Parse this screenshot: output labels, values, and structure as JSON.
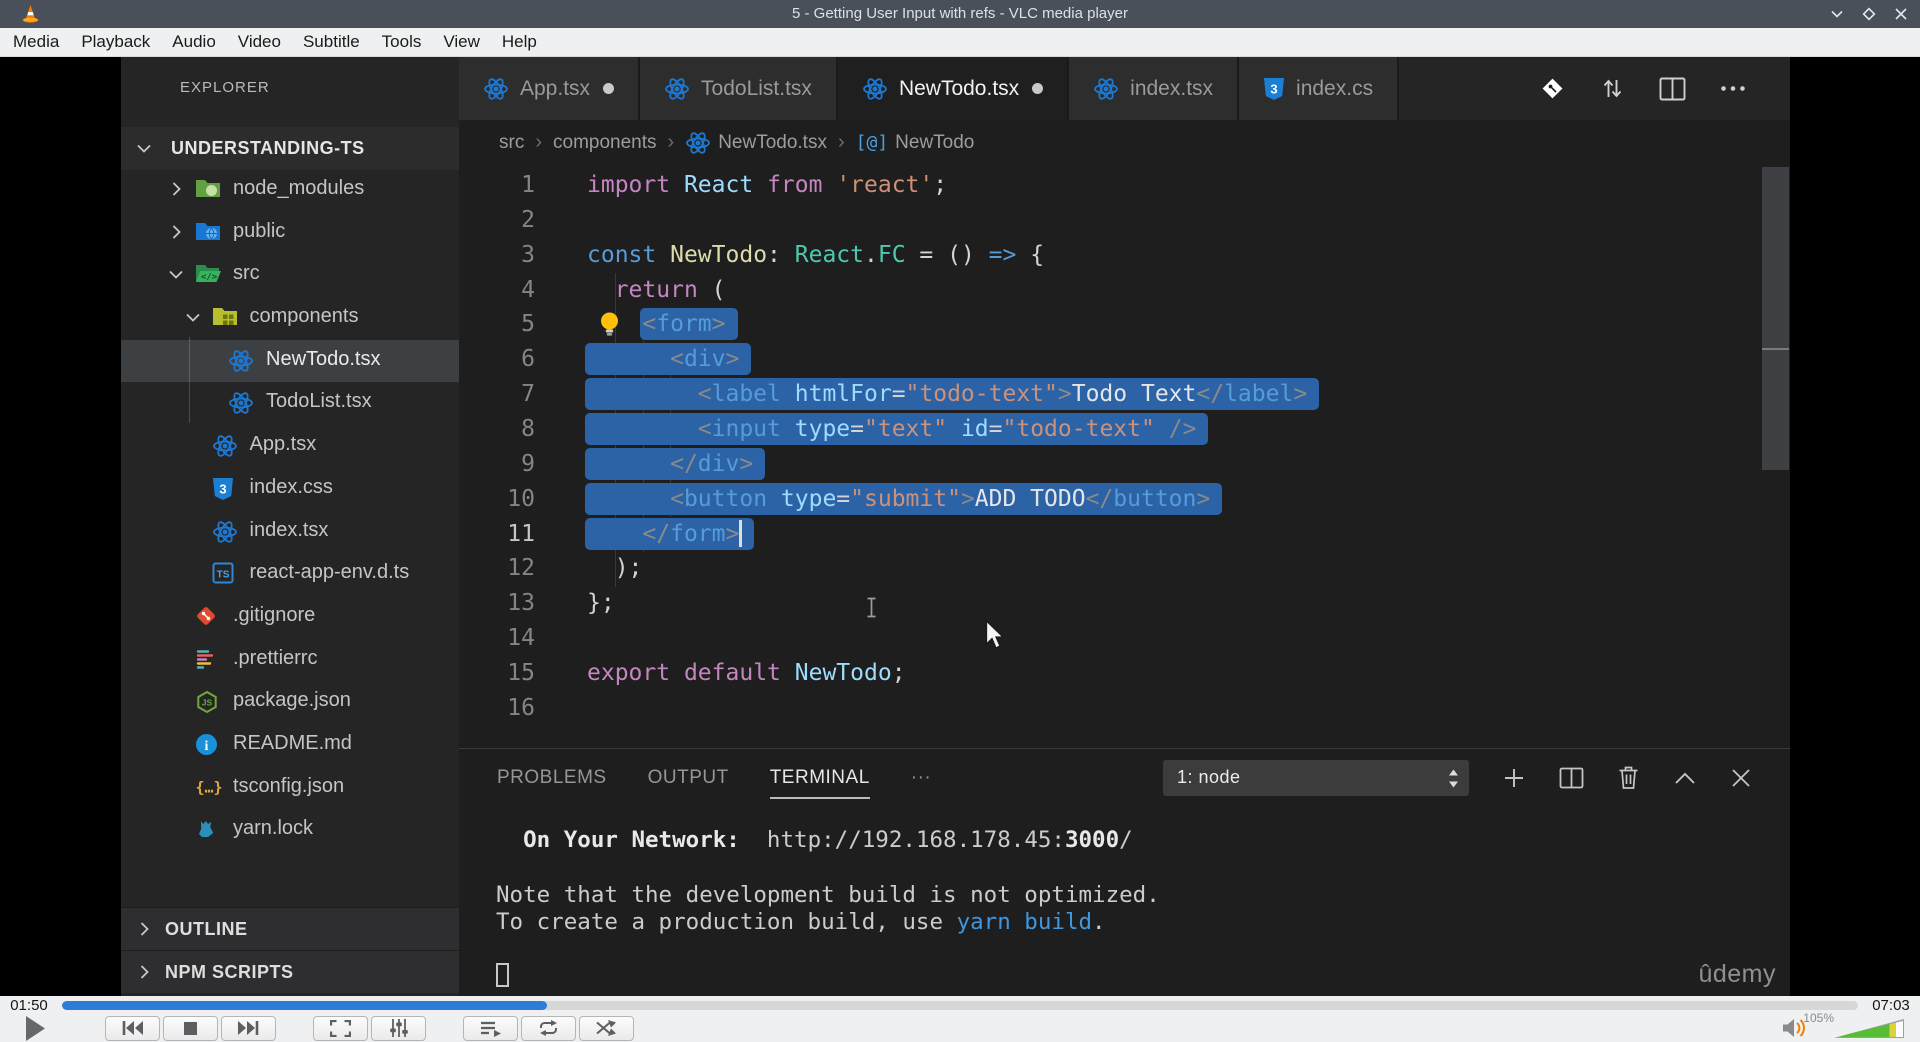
{
  "vlc": {
    "title": "5 - Getting User Input with refs - VLC media player",
    "menu": [
      "Media",
      "Playback",
      "Audio",
      "Video",
      "Subtitle",
      "Tools",
      "View",
      "Help"
    ],
    "window_controls": [
      "minimize",
      "maximize",
      "close"
    ],
    "seek": {
      "elapsed": "01:50",
      "total": "07:03",
      "progress_pct": 27
    },
    "button_groups": [
      [
        "skip-back",
        "stop",
        "skip-forward"
      ],
      [
        "fullscreen",
        "adjustments"
      ],
      [
        "playlist",
        "loop",
        "random"
      ]
    ],
    "volume": {
      "label": "105%",
      "fill_pct": 80
    },
    "colors": {
      "seek_fill": "#2e7cd6",
      "titlebar": "#4a5059",
      "menubar": "#eff0f1"
    }
  },
  "video": {
    "watermark": "ûdemy"
  },
  "vscode": {
    "explorer": {
      "header": "EXPLORER",
      "project": "UNDERSTANDING-TS",
      "items": [
        {
          "label": "node_modules",
          "icon": "folder-node-modules",
          "chevron": "right",
          "indent": 1
        },
        {
          "label": "public",
          "icon": "folder-public",
          "chevron": "right",
          "indent": 1
        },
        {
          "label": "src",
          "icon": "folder-src",
          "chevron": "down",
          "indent": 1
        },
        {
          "label": "components",
          "icon": "folder-components",
          "chevron": "down",
          "indent": 2
        },
        {
          "label": "NewTodo.tsx",
          "icon": "react",
          "indent": 3,
          "selected": true
        },
        {
          "label": "TodoList.tsx",
          "icon": "react",
          "indent": 3
        },
        {
          "label": "App.tsx",
          "icon": "react",
          "indent": 2
        },
        {
          "label": "index.css",
          "icon": "css",
          "indent": 2
        },
        {
          "label": "index.tsx",
          "icon": "react",
          "indent": 2
        },
        {
          "label": "react-app-env.d.ts",
          "icon": "ts",
          "indent": 2
        },
        {
          "label": ".gitignore",
          "icon": "git",
          "indent": 1
        },
        {
          "label": ".prettierrc",
          "icon": "prettier",
          "indent": 1
        },
        {
          "label": "package.json",
          "icon": "node",
          "indent": 1
        },
        {
          "label": "README.md",
          "icon": "info",
          "indent": 1
        },
        {
          "label": "tsconfig.json",
          "icon": "braces",
          "indent": 1
        },
        {
          "label": "yarn.lock",
          "icon": "yarn",
          "indent": 1
        }
      ],
      "sections": [
        {
          "label": "OUTLINE"
        },
        {
          "label": "NPM SCRIPTS"
        }
      ]
    },
    "tabs": [
      {
        "label": "App.tsx",
        "icon": "react",
        "modified": true,
        "active": false
      },
      {
        "label": "TodoList.tsx",
        "icon": "react",
        "modified": false,
        "active": false
      },
      {
        "label": "NewTodo.tsx",
        "icon": "react",
        "modified": true,
        "active": true
      },
      {
        "label": "index.tsx",
        "icon": "react",
        "modified": false,
        "active": false
      },
      {
        "label": "index.cs",
        "icon": "css",
        "modified": false,
        "active": false
      }
    ],
    "editor_actions": [
      "git-diamond",
      "swap-arrows",
      "split-editor",
      "more-actions"
    ],
    "breadcrumb": [
      {
        "label": "src"
      },
      {
        "label": "components"
      },
      {
        "label": "NewTodo.tsx",
        "icon": "react"
      },
      {
        "label": "NewTodo",
        "symbol": "[@]"
      }
    ],
    "code": {
      "token_colors": {
        "pl": "#d4d4d4",
        "kw": "#c586c0",
        "kw2": "#569cd6",
        "fn": "#dcdcaa",
        "type": "#4ec9b0",
        "var": "#9cdcfe",
        "str": "#ce9178",
        "tag": "#569cd6",
        "attr": "#9cdcfe",
        "punc": "#8a8a8a",
        "txt": "#e6e6e6"
      },
      "selection_color": "#2b63a6",
      "lines": [
        {
          "num": 1,
          "tokens": [
            [
              "kw",
              "import"
            ],
            [
              "pl",
              " "
            ],
            [
              "var",
              "React"
            ],
            [
              "pl",
              " "
            ],
            [
              "kw",
              "from"
            ],
            [
              "pl",
              " "
            ],
            [
              "str",
              "'react'"
            ],
            [
              "pl",
              ";"
            ]
          ]
        },
        {
          "num": 2,
          "tokens": []
        },
        {
          "num": 3,
          "tokens": [
            [
              "kw2",
              "const"
            ],
            [
              "pl",
              " "
            ],
            [
              "fn",
              "NewTodo"
            ],
            [
              "pl",
              ": "
            ],
            [
              "type",
              "React"
            ],
            [
              "pl",
              "."
            ],
            [
              "type",
              "FC"
            ],
            [
              "pl",
              " = () "
            ],
            [
              "kw2",
              "=>"
            ],
            [
              "pl",
              " {"
            ]
          ]
        },
        {
          "num": 4,
          "tokens": [
            [
              "pl",
              "  "
            ],
            [
              "kw",
              "return"
            ],
            [
              "pl",
              " ("
            ]
          ]
        },
        {
          "num": 5,
          "lightbulb": true,
          "tokens": [
            [
              "pl",
              "    "
            ]
          ],
          "sel": [
            [
              "punc",
              "<"
            ],
            [
              "tag",
              "form"
            ],
            [
              "punc",
              ">"
            ]
          ]
        },
        {
          "num": 6,
          "sel": [
            [
              "pl",
              "      "
            ],
            [
              "punc",
              "<"
            ],
            [
              "tag",
              "div"
            ],
            [
              "punc",
              ">"
            ]
          ]
        },
        {
          "num": 7,
          "sel": [
            [
              "pl",
              "        "
            ],
            [
              "punc",
              "<"
            ],
            [
              "tag",
              "label"
            ],
            [
              "pl",
              " "
            ],
            [
              "attr",
              "htmlFor"
            ],
            [
              "pl",
              "="
            ],
            [
              "str",
              "\"todo-text\""
            ],
            [
              "punc",
              ">"
            ],
            [
              "txt",
              "Todo Text"
            ],
            [
              "punc",
              "</"
            ],
            [
              "tag",
              "label"
            ],
            [
              "punc",
              ">"
            ]
          ]
        },
        {
          "num": 8,
          "sel": [
            [
              "pl",
              "        "
            ],
            [
              "punc",
              "<"
            ],
            [
              "tag",
              "input"
            ],
            [
              "pl",
              " "
            ],
            [
              "attr",
              "type"
            ],
            [
              "pl",
              "="
            ],
            [
              "str",
              "\"text\""
            ],
            [
              "pl",
              " "
            ],
            [
              "attr",
              "id"
            ],
            [
              "pl",
              "="
            ],
            [
              "str",
              "\"todo-text\""
            ],
            [
              "pl",
              " "
            ],
            [
              "punc",
              "/>"
            ]
          ]
        },
        {
          "num": 9,
          "sel": [
            [
              "pl",
              "      "
            ],
            [
              "punc",
              "</"
            ],
            [
              "tag",
              "div"
            ],
            [
              "punc",
              ">"
            ]
          ]
        },
        {
          "num": 10,
          "sel": [
            [
              "pl",
              "      "
            ],
            [
              "punc",
              "<"
            ],
            [
              "tag",
              "button"
            ],
            [
              "pl",
              " "
            ],
            [
              "attr",
              "type"
            ],
            [
              "pl",
              "="
            ],
            [
              "str",
              "\"submit\""
            ],
            [
              "punc",
              ">"
            ],
            [
              "txt",
              "ADD TODO"
            ],
            [
              "punc",
              "</"
            ],
            [
              "tag",
              "button"
            ],
            [
              "punc",
              ">"
            ]
          ]
        },
        {
          "num": 11,
          "active": true,
          "caret": true,
          "sel": [
            [
              "pl",
              "    "
            ],
            [
              "punc",
              "</"
            ],
            [
              "tag",
              "form"
            ],
            [
              "punc",
              ">"
            ]
          ]
        },
        {
          "num": 12,
          "tokens": [
            [
              "pl",
              "  );"
            ]
          ]
        },
        {
          "num": 13,
          "tokens": [
            [
              "pl",
              "};"
            ]
          ]
        },
        {
          "num": 14,
          "tokens": []
        },
        {
          "num": 15,
          "tokens": [
            [
              "kw",
              "export"
            ],
            [
              "pl",
              " "
            ],
            [
              "kw",
              "default"
            ],
            [
              "pl",
              " "
            ],
            [
              "var",
              "NewTodo"
            ],
            [
              "pl",
              ";"
            ]
          ]
        },
        {
          "num": 16,
          "tokens": []
        }
      ]
    },
    "panel": {
      "tabs": [
        {
          "label": "PROBLEMS",
          "active": false
        },
        {
          "label": "OUTPUT",
          "active": false
        },
        {
          "label": "TERMINAL",
          "active": true
        },
        {
          "label": "···",
          "active": false
        }
      ],
      "dropdown": "1: node",
      "actions": [
        "new-terminal",
        "split-terminal",
        "kill-terminal",
        "maximize-panel",
        "close-panel"
      ],
      "terminal": [
        {
          "segs": [
            [
              "pl",
              "  "
            ],
            [
              "b",
              "On Your Network:"
            ],
            [
              "pl",
              "  http://192.168.178.45:"
            ],
            [
              "b",
              "3000"
            ],
            [
              "pl",
              "/"
            ]
          ]
        },
        {
          "segs": []
        },
        {
          "segs": [
            [
              "pl",
              "Note that the development build is not optimized."
            ]
          ]
        },
        {
          "segs": [
            [
              "pl",
              "To create a production build, use "
            ],
            [
              "blue",
              "yarn build"
            ],
            [
              "pl",
              "."
            ]
          ]
        },
        {
          "segs": []
        },
        {
          "segs": [],
          "cursor": true
        }
      ]
    }
  }
}
